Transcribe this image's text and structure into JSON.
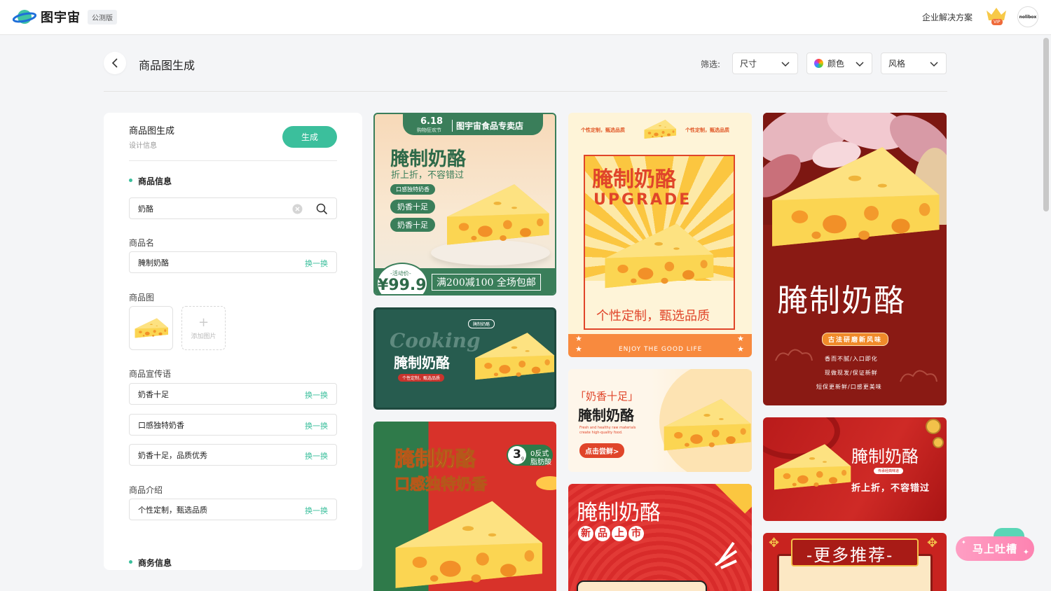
{
  "header": {
    "app_name": "图宇宙",
    "beta_badge": "公测版",
    "enterprise": "企业解决方案",
    "vip_label": "VIP",
    "avatar_text": "nolibox"
  },
  "page": {
    "title": "商品图生成",
    "filter_label": "筛选:",
    "filters": [
      "尺寸",
      "颜色",
      "风格"
    ]
  },
  "panel": {
    "title": "商品图生成",
    "subtitle": "设计信息",
    "generate_label": "生成",
    "section_product": "商品信息",
    "search_value": "奶酪",
    "name_label": "商品名",
    "name_value": "腌制奶酪",
    "swap_label": "换一换",
    "image_label": "商品图",
    "add_image_label": "添加图片",
    "slogan_label": "商品宣传语",
    "slogans": [
      "奶香十足",
      "口感独特奶香",
      "奶香十足，品质优秀"
    ],
    "intro_label": "商品介绍",
    "intro_value": "个性定制，甄选品质",
    "section_business": "商务信息"
  },
  "cards": {
    "c1": {
      "date": "6.18",
      "date_sub": "购物狂欢节",
      "shop": "图宇宙食品专卖店",
      "title": "腌制奶酪",
      "sub": "折上折，不容错过",
      "tag1": "口感独特奶香",
      "tag2": "奶香十足",
      "tag3": "奶香十足",
      "price_label": "-活动价-",
      "price": "¥99.9",
      "promo": "满200减100 全场包邮"
    },
    "c2": {
      "pill": "腌制奶酪",
      "script": "Cooking",
      "title": "腌制奶酪",
      "sub": "个性定制，甄选品质"
    },
    "c3": {
      "title1": "腌制奶酪",
      "title2": "口感独特奶香",
      "badge_num": "3",
      "badge_small": "g",
      "badge1": "0反式",
      "badge2": "脂肪酸"
    },
    "c4": {
      "top_left": "个性定制，甄选品质",
      "top_right": "个性定制，甄选品质",
      "title": "腌制奶酪",
      "upgrade": "UPGRADE",
      "tagline": "个性定制，甄选品质",
      "footer": "ENJOY THE GOOD LIFE"
    },
    "c5": {
      "quote": "「奶香十足」",
      "title": "腌制奶酪",
      "en1": "Fresh and healthy raw materials",
      "en2": "create high-quality food.",
      "button": "点击尝鲜>"
    },
    "c6": {
      "title": "腌制奶酪",
      "c1": "新",
      "c2": "品",
      "c3": "上",
      "c4": "市"
    },
    "c7": {
      "title": "腌制奶酪",
      "pill": "古法研磨新风味",
      "l1": "香而不腻/入口即化",
      "l2": "现做现发/保证新鲜",
      "l3": "短保更新鲜/口感更美味"
    },
    "c8": {
      "title": "腌制奶酪",
      "pill": "传承经典味道",
      "sub": "折上折，不容错过"
    },
    "c9": {
      "title": "-更多推荐-"
    }
  },
  "feedback": {
    "label": "马上吐槽"
  },
  "colors": {
    "accent": "#3bbf9c",
    "c1_green": "#3a7e5a",
    "c2_teal": "#275c4f",
    "c3_red": "#d8322a",
    "c4_orange": "#f88a3e",
    "c7_maroon": "#8a1a14",
    "feedback_pink": "#fd83b1"
  }
}
